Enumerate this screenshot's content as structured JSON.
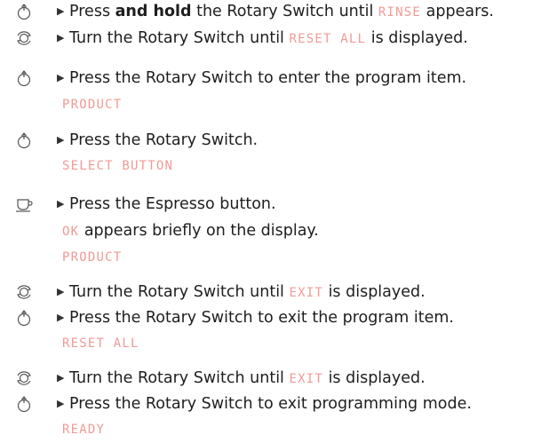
{
  "display_color": "#f19a96",
  "icons": {
    "press": "press-rotary-switch-icon",
    "turn": "turn-rotary-switch-icon",
    "cup": "espresso-cup-icon"
  },
  "steps": {
    "s1": {
      "a": "Press ",
      "b": "and hold",
      "c": " the Rotary Switch until ",
      "disp": "RINSE",
      "d": " appears."
    },
    "s2": {
      "a": "Turn the Rotary Switch until ",
      "disp": "RESET ALL",
      "b": " is displayed."
    },
    "s3": {
      "a": "Press the Rotary Switch to enter the program item.",
      "disp": "PRODUCT"
    },
    "s4": {
      "a": "Press the Rotary Switch.",
      "disp": "SELECT BUTTON"
    },
    "s5": {
      "a": "Press the Espresso button.",
      "disp_ok": "OK",
      "b": " appears briefly on the display.",
      "disp": "PRODUCT"
    },
    "s6": {
      "a": "Turn the Rotary Switch until ",
      "disp": "EXIT",
      "b": " is displayed."
    },
    "s7": {
      "a": "Press the Rotary Switch to exit the program item.",
      "disp": "RESET ALL"
    },
    "s8": {
      "a": "Turn the Rotary Switch until ",
      "disp": "EXIT",
      "b": " is displayed."
    },
    "s9": {
      "a": "Press the Rotary Switch to exit programming mode.",
      "disp": "READY"
    }
  }
}
